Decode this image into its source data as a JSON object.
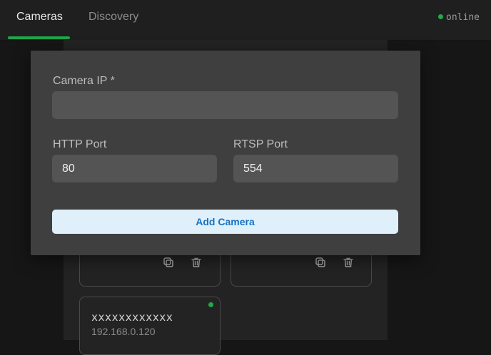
{
  "tabs": [
    {
      "label": "Cameras",
      "active": true
    },
    {
      "label": "Discovery",
      "active": false
    }
  ],
  "status": {
    "label": "online",
    "color": "#22a84a"
  },
  "modal": {
    "camera_ip": {
      "label": "Camera IP *",
      "value": "",
      "placeholder": ""
    },
    "http_port": {
      "label": "HTTP Port",
      "value": "80"
    },
    "rtsp_port": {
      "label": "RTSP Port",
      "value": "554"
    },
    "add_button": "Add Camera"
  },
  "cards": [
    {
      "name": "xxxxxxxxxxxx",
      "ip": "192.168.0.120",
      "online": true
    }
  ],
  "icons": {
    "copy": "copy-icon",
    "delete": "trash-icon"
  },
  "colors": {
    "accent": "#1fa64a",
    "button_bg": "#dff0fb",
    "button_text": "#1673c2"
  }
}
